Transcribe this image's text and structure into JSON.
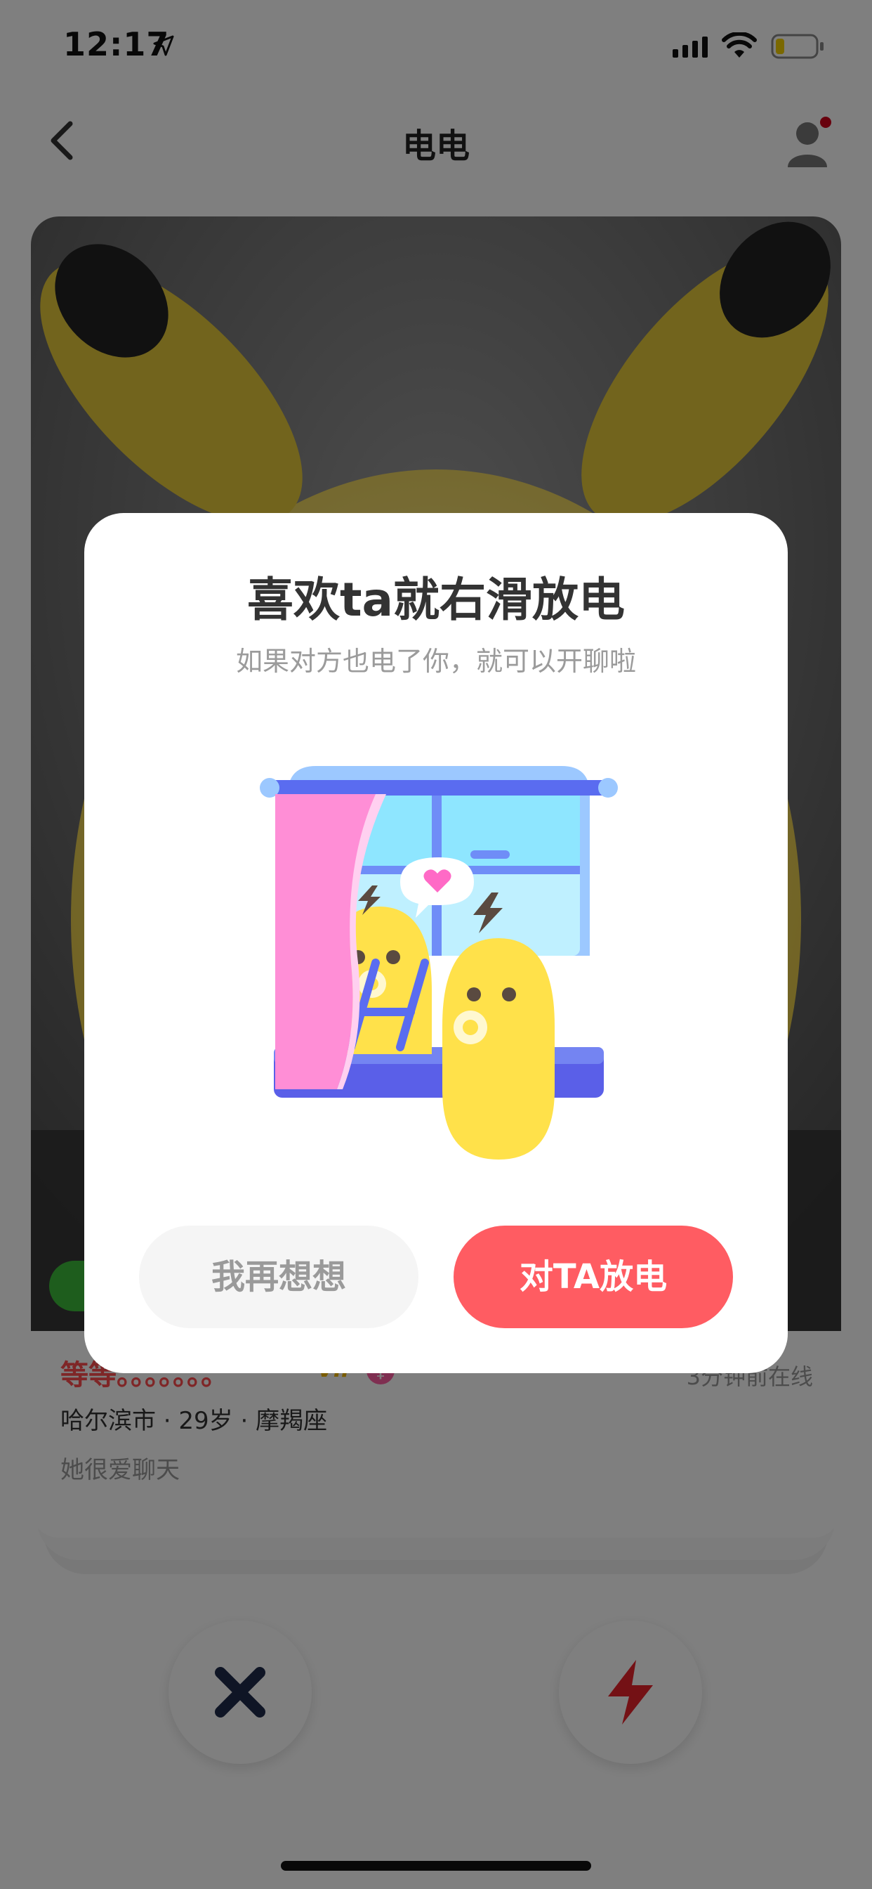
{
  "status_bar": {
    "time": "12:17",
    "icons": [
      "location-arrow-icon",
      "signal-icon",
      "wifi-icon",
      "battery-icon"
    ]
  },
  "nav": {
    "title": "电电",
    "back_icon": "chevron-left-icon",
    "profile_icon": "user-icon"
  },
  "card": {
    "name": "等等。。。。。。。",
    "vip_label": "VIP",
    "gender_icon": "female-icon",
    "online_status": "3分钟前在线",
    "meta": "哈尔滨市 · 29岁 · 摩羯座",
    "bio": "她很爱聊天"
  },
  "actions": {
    "dislike_icon": "close-icon",
    "like_icon": "lightning-icon"
  },
  "dialog": {
    "title": "喜欢ta就右滑放电",
    "subtitle": "如果对方也电了你，就可以开聊啦",
    "illustration_icon": "window-couple-illustration",
    "secondary_button": "我再想想",
    "primary_button": "对TA放电"
  },
  "colors": {
    "accent": "#ff5c62",
    "name_red": "#ff4d4f",
    "vip_gold": "#f2b800"
  }
}
